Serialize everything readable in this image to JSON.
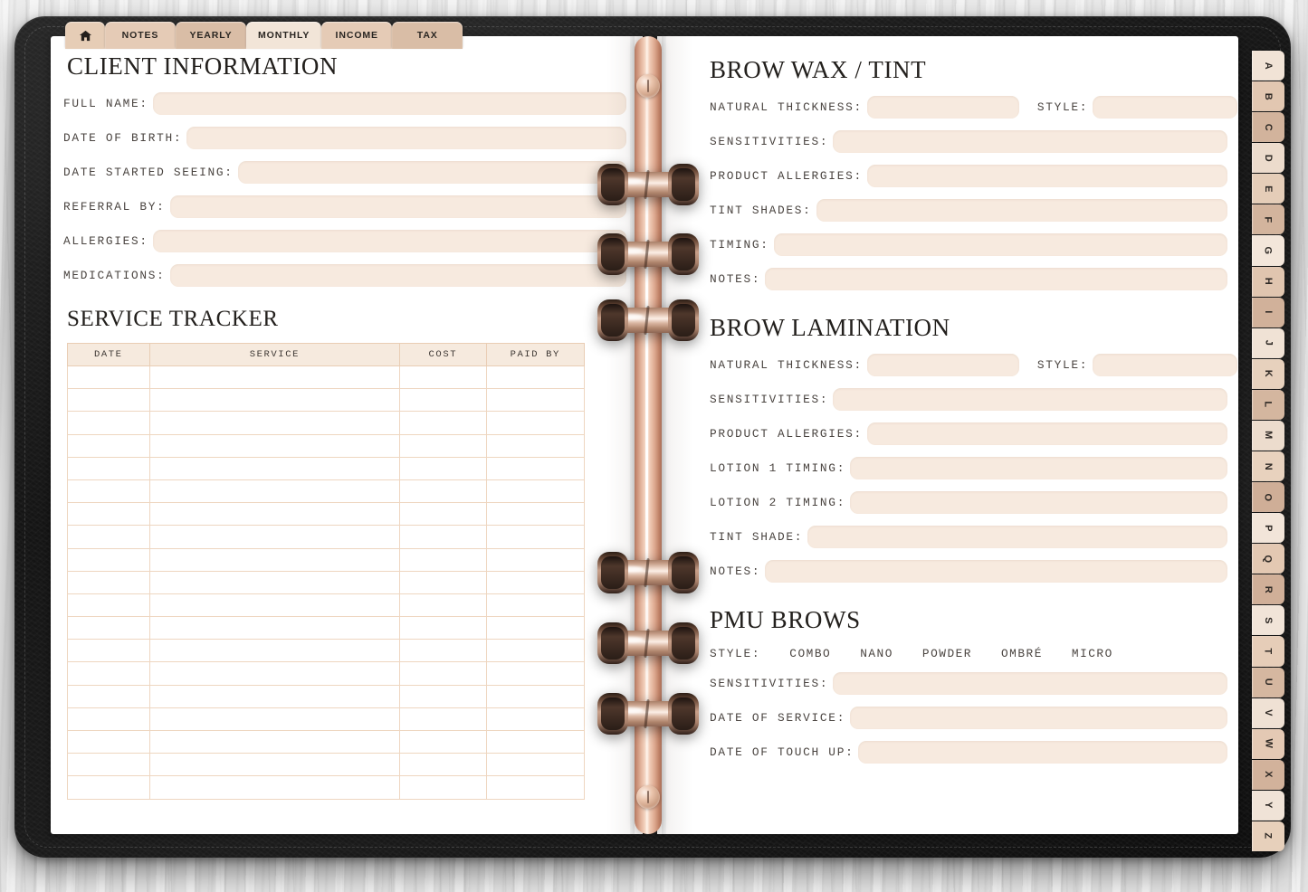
{
  "top_tabs": [
    {
      "label": "",
      "icon": "home-icon",
      "color": "#e6cdb6",
      "name": "home"
    },
    {
      "label": "NOTES",
      "color": "#e5cbb6",
      "name": "notes"
    },
    {
      "label": "YEARLY",
      "color": "#d9bda6",
      "name": "yearly"
    },
    {
      "label": "MONTHLY",
      "color": "#f2e5d8",
      "name": "monthly"
    },
    {
      "label": "INCOME",
      "color": "#e5cbb6",
      "name": "income"
    },
    {
      "label": "TAX",
      "color": "#d9bda6",
      "name": "tax"
    }
  ],
  "alphabet_tabs": [
    {
      "letter": "A",
      "color": "#f1e3d6"
    },
    {
      "letter": "B",
      "color": "#e2c7b1"
    },
    {
      "letter": "C",
      "color": "#d2b39c"
    },
    {
      "letter": "D",
      "color": "#ecdbcc"
    },
    {
      "letter": "E",
      "color": "#e5cdb8"
    },
    {
      "letter": "F",
      "color": "#d3b49d"
    },
    {
      "letter": "G",
      "color": "#f3e6da"
    },
    {
      "letter": "H",
      "color": "#e0c5af"
    },
    {
      "letter": "I",
      "color": "#d1b19a"
    },
    {
      "letter": "J",
      "color": "#f0e2d5"
    },
    {
      "letter": "K",
      "color": "#e7d1bd"
    },
    {
      "letter": "L",
      "color": "#d4b69f"
    },
    {
      "letter": "M",
      "color": "#ecdccd"
    },
    {
      "letter": "N",
      "color": "#e8d2be"
    },
    {
      "letter": "O",
      "color": "#cfae97"
    },
    {
      "letter": "P",
      "color": "#f2e5d9"
    },
    {
      "letter": "Q",
      "color": "#e3c8b2"
    },
    {
      "letter": "R",
      "color": "#d0af98"
    },
    {
      "letter": "S",
      "color": "#f1e4d8"
    },
    {
      "letter": "T",
      "color": "#e6cdb8"
    },
    {
      "letter": "U",
      "color": "#d5b7a0"
    },
    {
      "letter": "V",
      "color": "#efe1d4"
    },
    {
      "letter": "W",
      "color": "#e4c9b4"
    },
    {
      "letter": "X",
      "color": "#d2b29b"
    },
    {
      "letter": "Y",
      "color": "#f0e3d7"
    },
    {
      "letter": "Z",
      "color": "#e7d0bb"
    }
  ],
  "left_page": {
    "client_information": {
      "title": "CLIENT INFORMATION",
      "fields": [
        {
          "label": "FULL NAME:",
          "value": "",
          "placeholder": ""
        },
        {
          "label": "DATE OF BIRTH:",
          "value": "",
          "placeholder": ""
        },
        {
          "label": "DATE STARTED SEEING:",
          "value": "",
          "placeholder": ""
        },
        {
          "label": "REFERRAL BY:",
          "value": "",
          "placeholder": ""
        },
        {
          "label": "ALLERGIES:",
          "value": "",
          "placeholder": ""
        },
        {
          "label": "MEDICATIONS:",
          "value": "",
          "placeholder": ""
        }
      ]
    },
    "service_tracker": {
      "title": "SERVICE TRACKER",
      "columns": [
        "DATE",
        "SERVICE",
        "COST",
        "PAID BY"
      ],
      "rows": [
        [
          "",
          "",
          "",
          ""
        ],
        [
          "",
          "",
          "",
          ""
        ],
        [
          "",
          "",
          "",
          ""
        ],
        [
          "",
          "",
          "",
          ""
        ],
        [
          "",
          "",
          "",
          ""
        ],
        [
          "",
          "",
          "",
          ""
        ],
        [
          "",
          "",
          "",
          ""
        ],
        [
          "",
          "",
          "",
          ""
        ],
        [
          "",
          "",
          "",
          ""
        ],
        [
          "",
          "",
          "",
          ""
        ],
        [
          "",
          "",
          "",
          ""
        ],
        [
          "",
          "",
          "",
          ""
        ],
        [
          "",
          "",
          "",
          ""
        ],
        [
          "",
          "",
          "",
          ""
        ],
        [
          "",
          "",
          "",
          ""
        ],
        [
          "",
          "",
          "",
          ""
        ],
        [
          "",
          "",
          "",
          ""
        ],
        [
          "",
          "",
          "",
          ""
        ],
        [
          "",
          "",
          "",
          ""
        ]
      ]
    }
  },
  "right_page": {
    "brow_wax_tint": {
      "title": "BROW WAX / TINT",
      "fields": [
        {
          "label": "NATURAL THICKNESS:",
          "value": "",
          "size": "sm"
        },
        {
          "label": "STYLE:",
          "value": "",
          "size": "sm2",
          "inline": true
        },
        {
          "label": "SENSITIVITIES:",
          "value": ""
        },
        {
          "label": "PRODUCT ALLERGIES:",
          "value": ""
        },
        {
          "label": "TINT SHADES:",
          "value": ""
        },
        {
          "label": "TIMING:",
          "value": ""
        },
        {
          "label": "NOTES:",
          "value": ""
        }
      ]
    },
    "brow_lamination": {
      "title": "BROW LAMINATION",
      "fields": [
        {
          "label": "NATURAL THICKNESS:",
          "value": "",
          "size": "sm"
        },
        {
          "label": "STYLE:",
          "value": "",
          "size": "sm2",
          "inline": true
        },
        {
          "label": "SENSITIVITIES:",
          "value": ""
        },
        {
          "label": "PRODUCT ALLERGIES:",
          "value": ""
        },
        {
          "label": "LOTION 1 TIMING:",
          "value": ""
        },
        {
          "label": "LOTION 2 TIMING:",
          "value": ""
        },
        {
          "label": "TINT SHADE:",
          "value": ""
        },
        {
          "label": "NOTES:",
          "value": ""
        }
      ]
    },
    "pmu_brows": {
      "title": "PMU BROWS",
      "style_label": "STYLE:",
      "style_options": [
        "COMBO",
        "NANO",
        "POWDER",
        "OMBRÉ",
        "MICRO"
      ],
      "fields": [
        {
          "label": "SENSITIVITIES:",
          "value": ""
        },
        {
          "label": "DATE OF SERVICE:",
          "value": ""
        },
        {
          "label": "DATE OF TOUCH UP:",
          "value": ""
        }
      ]
    }
  },
  "theme": {
    "field_fill": "#f7eadf",
    "table_header_fill": "#f6eade",
    "grid_line": "#eed6c0",
    "heading_color": "#23201d",
    "label_color": "#4a4440",
    "ring_metal": "#d8b49f",
    "cover_color": "#141414"
  }
}
